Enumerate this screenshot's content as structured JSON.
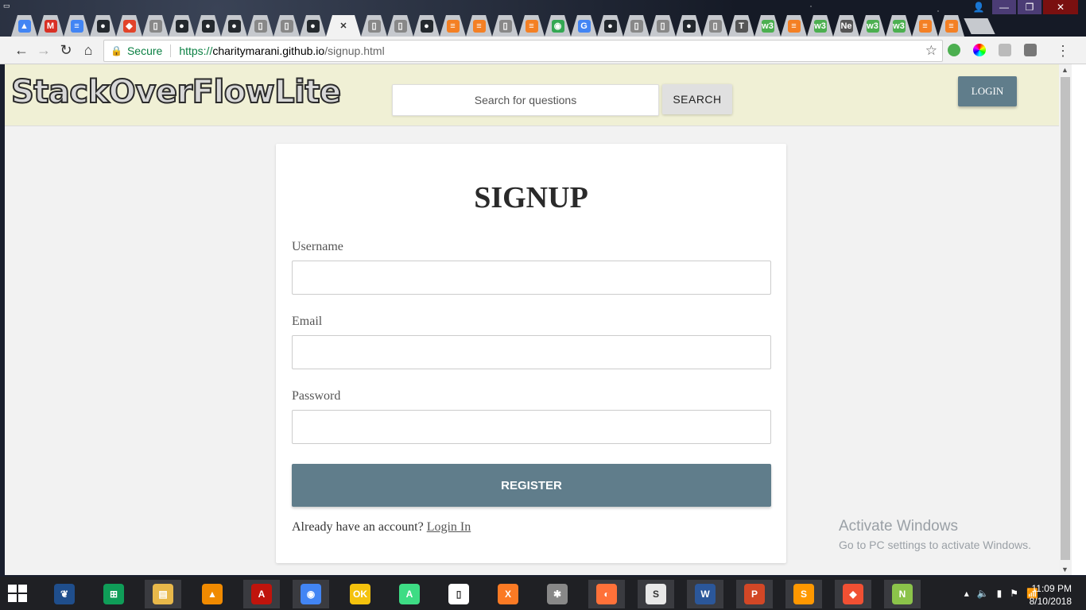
{
  "browser": {
    "tabs": [
      {
        "icon": "google-ads-icon",
        "color": "#4285f4",
        "glyph": "▲"
      },
      {
        "icon": "gmail-icon",
        "color": "#d93025",
        "glyph": "M"
      },
      {
        "icon": "google-docs-icon",
        "color": "#4285f4",
        "glyph": "≡"
      },
      {
        "icon": "github-icon",
        "color": "#24292e",
        "glyph": "●"
      },
      {
        "icon": "gitlab-icon",
        "color": "#e24329",
        "glyph": "◆"
      },
      {
        "icon": "page-icon",
        "color": "#888888",
        "glyph": "▯"
      },
      {
        "icon": "github-icon",
        "color": "#24292e",
        "glyph": "●"
      },
      {
        "icon": "github-icon",
        "color": "#24292e",
        "glyph": "●"
      },
      {
        "icon": "github-icon",
        "color": "#24292e",
        "glyph": "●"
      },
      {
        "icon": "page-icon",
        "color": "#888888",
        "glyph": "▯"
      },
      {
        "icon": "page-icon",
        "color": "#888888",
        "glyph": "▯"
      },
      {
        "icon": "github-icon",
        "color": "#24292e",
        "glyph": "●"
      },
      {
        "icon": "close-icon",
        "color": "#333333",
        "glyph": "✕",
        "active": true
      },
      {
        "icon": "page-icon",
        "color": "#888888",
        "glyph": "▯"
      },
      {
        "icon": "page-icon",
        "color": "#888888",
        "glyph": "▯"
      },
      {
        "icon": "github-icon",
        "color": "#24292e",
        "glyph": "●"
      },
      {
        "icon": "stackoverflow-icon",
        "color": "#f48024",
        "glyph": "≡"
      },
      {
        "icon": "stackoverflow-icon",
        "color": "#f48024",
        "glyph": "≡"
      },
      {
        "icon": "page-icon",
        "color": "#888888",
        "glyph": "▯"
      },
      {
        "icon": "stackoverflow-icon",
        "color": "#f48024",
        "glyph": "≡"
      },
      {
        "icon": "chrome-icon",
        "color": "#34a853",
        "glyph": "◉"
      },
      {
        "icon": "google-icon",
        "color": "#4285f4",
        "glyph": "G"
      },
      {
        "icon": "github-icon",
        "color": "#24292e",
        "glyph": "●"
      },
      {
        "icon": "page-icon",
        "color": "#888888",
        "glyph": "▯"
      },
      {
        "icon": "page-icon",
        "color": "#888888",
        "glyph": "▯"
      },
      {
        "icon": "github-icon",
        "color": "#24292e",
        "glyph": "●"
      },
      {
        "icon": "page-icon",
        "color": "#888888",
        "glyph": "▯"
      },
      {
        "icon": "text-icon",
        "color": "#555555",
        "glyph": "T"
      },
      {
        "icon": "w3schools-icon",
        "color": "#4caf50",
        "glyph": "w3"
      },
      {
        "icon": "stackoverflow-icon",
        "color": "#f48024",
        "glyph": "≡"
      },
      {
        "icon": "w3schools-icon",
        "color": "#4caf50",
        "glyph": "w3"
      },
      {
        "icon": "text-tab",
        "color": "#555555",
        "glyph": "Ne"
      },
      {
        "icon": "w3schools-icon",
        "color": "#4caf50",
        "glyph": "w3"
      },
      {
        "icon": "w3schools-icon",
        "color": "#4caf50",
        "glyph": "w3"
      },
      {
        "icon": "stackoverflow-icon",
        "color": "#f48024",
        "glyph": "≡"
      },
      {
        "icon": "stackoverflow-icon",
        "color": "#f48024",
        "glyph": "≡"
      }
    ],
    "secure_label": "Secure",
    "url_scheme": "https://",
    "url_domain": "charitymarani.github.io",
    "url_path": "/signup.html"
  },
  "header": {
    "logo_text": "StackOverFlowLite",
    "search_placeholder": "Search for questions",
    "search_button": "SEARCH",
    "login_button": "LOGIN"
  },
  "form": {
    "title": "SIGNUP",
    "username_label": "Username",
    "email_label": "Email",
    "password_label": "Password",
    "register_button": "REGISTER",
    "already_text": "Already have an account?",
    "login_link": "Login In"
  },
  "watermark": {
    "line1": "Activate Windows",
    "line2": "Go to PC settings to activate Windows."
  },
  "taskbar": {
    "apps": [
      {
        "name": "sourcetree-icon",
        "color": "#1f4e8c",
        "glyph": "❦",
        "open": false
      },
      {
        "name": "store-icon",
        "color": "#0f9d58",
        "glyph": "⊞",
        "open": false
      },
      {
        "name": "file-explorer-icon",
        "color": "#e8b84a",
        "glyph": "▤",
        "open": true
      },
      {
        "name": "vlc-icon",
        "color": "#f08a00",
        "glyph": "▲",
        "open": false
      },
      {
        "name": "acrobat-icon",
        "color": "#c0140c",
        "glyph": "A",
        "open": true
      },
      {
        "name": "chrome-icon",
        "color": "#4285f4",
        "glyph": "◉",
        "open": true
      },
      {
        "name": "google-ok-icon",
        "color": "#f4c20d",
        "glyph": "OK",
        "open": false
      },
      {
        "name": "android-studio-icon",
        "color": "#3ddc84",
        "glyph": "A",
        "open": false
      },
      {
        "name": "notepad-icon",
        "color": "#ffffff",
        "glyph": "▯",
        "open": false
      },
      {
        "name": "xampp-icon",
        "color": "#fb7a24",
        "glyph": "X",
        "open": false
      },
      {
        "name": "spider-icon",
        "color": "#888888",
        "glyph": "✱",
        "open": false
      },
      {
        "name": "firefox-icon",
        "color": "#ff7139",
        "glyph": "◐",
        "open": true
      },
      {
        "name": "slack-icon",
        "color": "#e8e8e8",
        "glyph": "S",
        "open": true
      },
      {
        "name": "word-icon",
        "color": "#2b579a",
        "glyph": "W",
        "open": true
      },
      {
        "name": "powerpoint-icon",
        "color": "#d24726",
        "glyph": "P",
        "open": true
      },
      {
        "name": "sublime-icon",
        "color": "#ff9800",
        "glyph": "S",
        "open": true
      },
      {
        "name": "git-icon",
        "color": "#f05033",
        "glyph": "◆",
        "open": true
      },
      {
        "name": "notepad-plus-icon",
        "color": "#8bc34a",
        "glyph": "N",
        "open": true
      }
    ],
    "time": "11:09 PM",
    "date": "8/10/2018"
  }
}
